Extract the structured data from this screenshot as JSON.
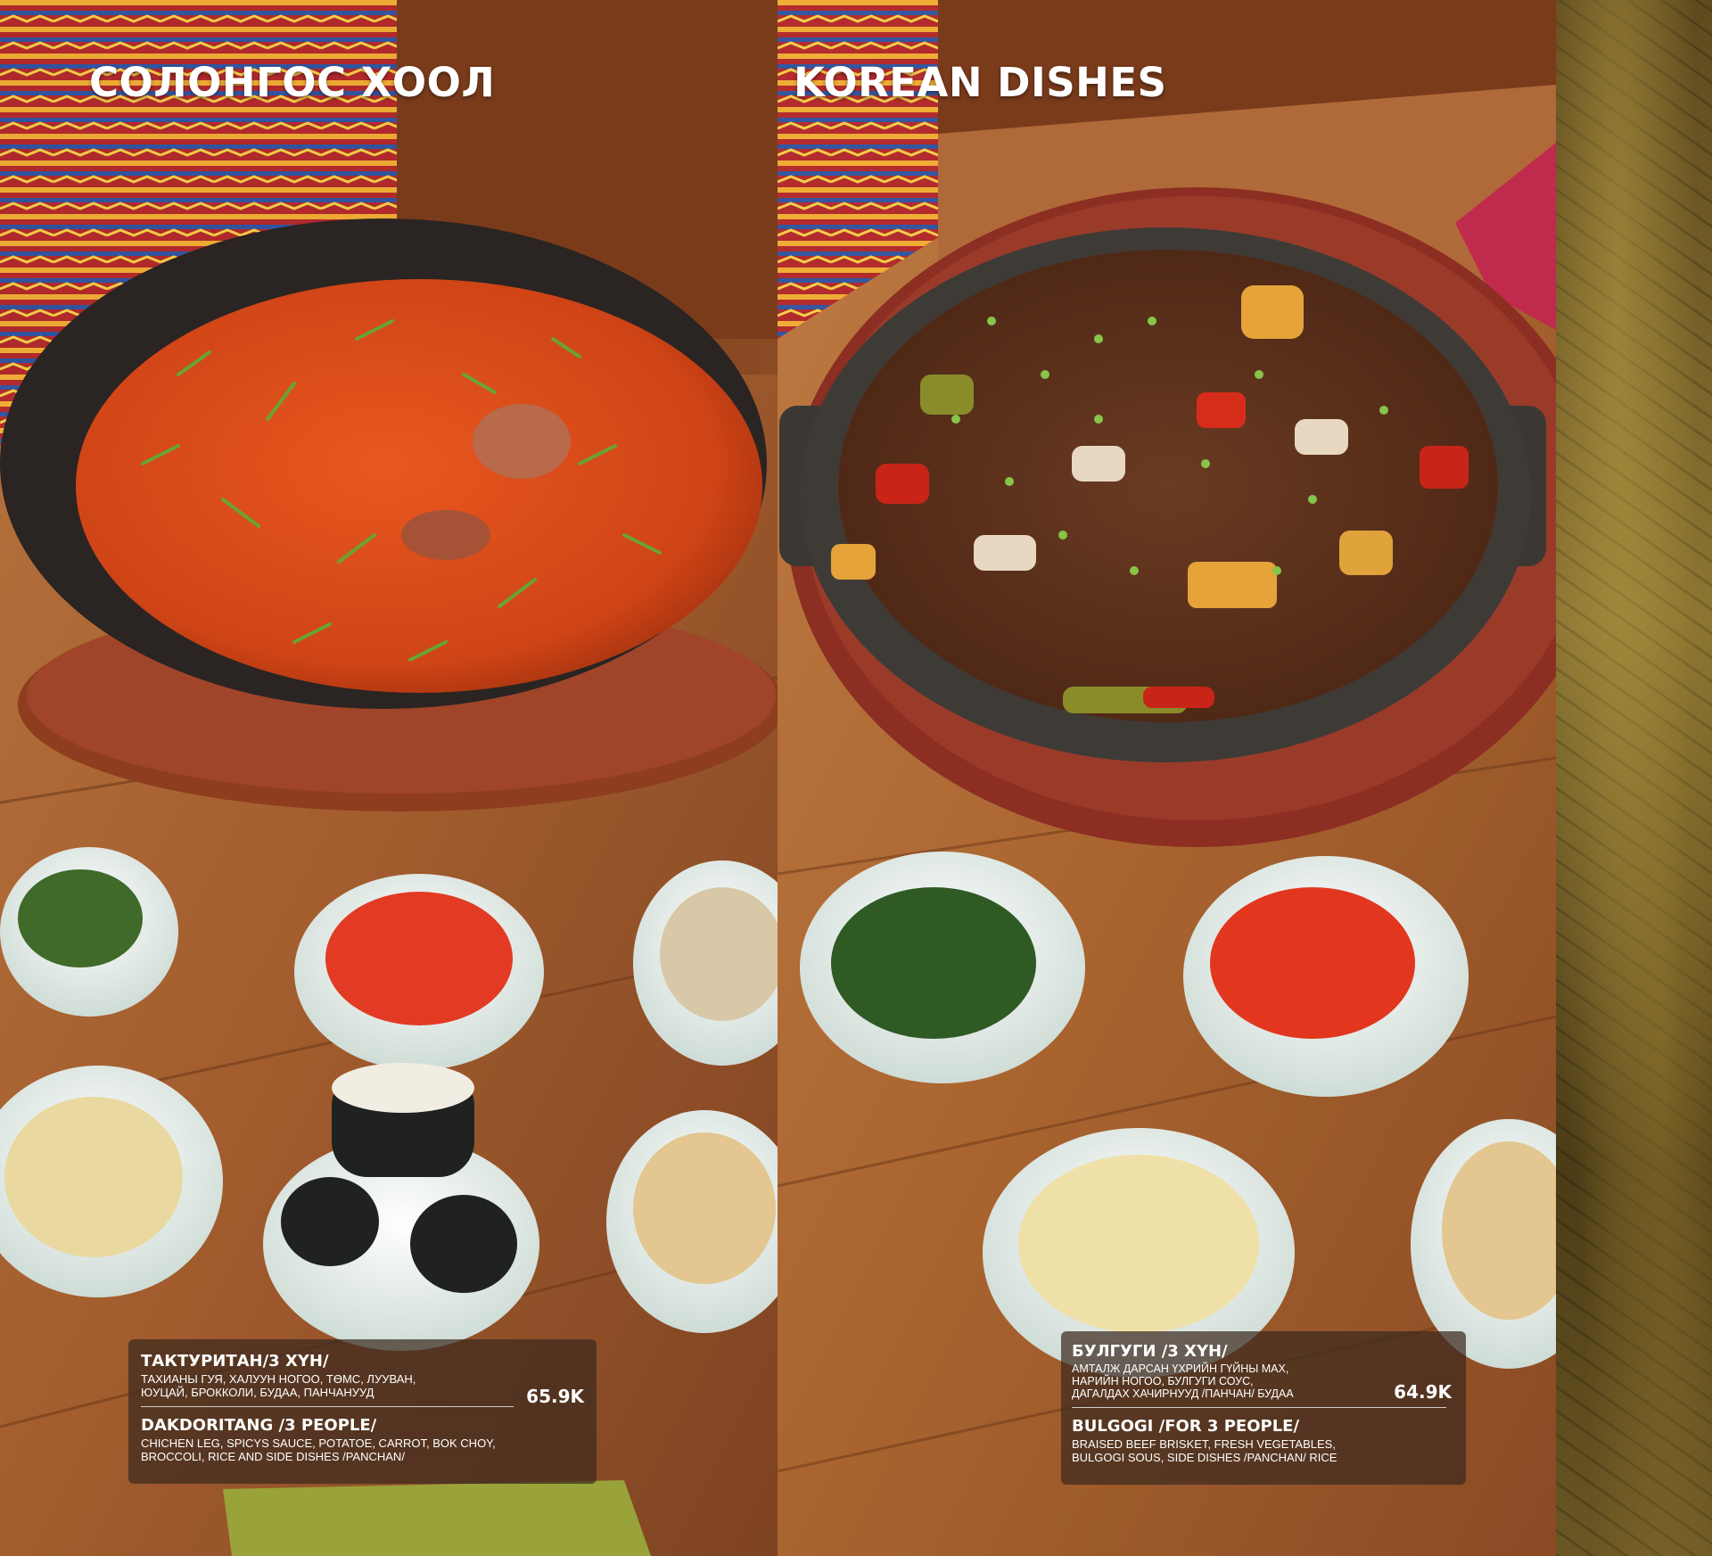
{
  "menu": {
    "left_page": {
      "title": "СОЛОНГОС ХООЛ",
      "dish": {
        "name_mn": "ТАКТУРИТАН/3 ХҮН/",
        "description_mn": "ТАХИАНЫ ГУЯ, ХАЛУУН НОГОО, ТӨМС, ЛУУВАН,\nЮУЦАЙ, БРОККОЛИ, БУДАА, ПАНЧАНУУД",
        "price": "65.9K",
        "name_en": "DAKDORITANG /3 PEOPLE/",
        "description_en": "CHICHEN LEG, SPICYS SAUCE, POTATOE, CARROT, BOK CHOY,\n BROCCOLI, RICE AND SIDE DISHES /PANCHAN/"
      }
    },
    "right_page": {
      "title": "KOREAN DISHES",
      "dish": {
        "name_mn": "БУЛГУГИ /3 ХҮН/",
        "description_mn": "АМТАЛЖ ДАРСАН ҮХРИЙН ГҮЙНЫ МАХ,\nНАРИЙН НОГОО, БУЛГУГИ СОУС,\nДАГАЛДАХ ХАЧИРНУУД /ПАНЧАН/ БУДАА",
        "price": "64.9K",
        "name_en": "BULGOGI /FOR 3 PEOPLE/",
        "description_en": "BRAISED BEEF BRISKET, FRESH VEGETABLES,\nBULGOGI SOUS, SIDE DISHES /PANCHAN/ RICE"
      }
    }
  },
  "colors": {
    "wood": "#a8683a",
    "sauce": "#d2481a",
    "bowl": "#e9f0ec",
    "card": "#3c2a1e",
    "accent_strip": "#7a6428"
  }
}
